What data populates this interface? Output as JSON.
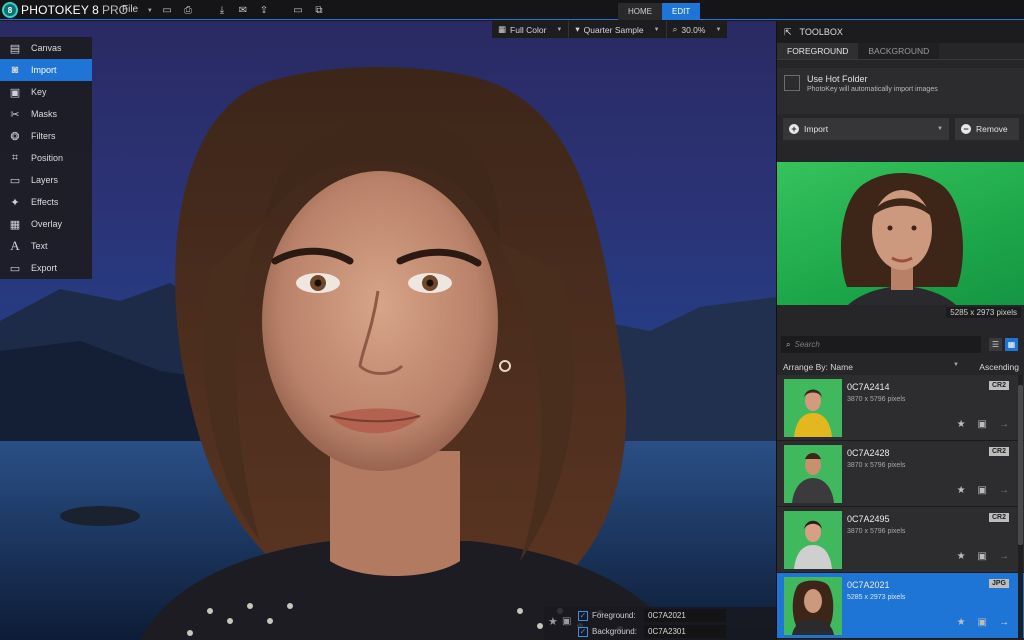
{
  "app": {
    "logo_name": "PHOTOKEY",
    "logo_version": "8",
    "logo_edition": "PRO"
  },
  "menu": {
    "file": "File"
  },
  "modes": {
    "home": "HOME",
    "edit": "EDIT"
  },
  "view_bar": {
    "color_mode": "Full Color",
    "sample": "Quarter Sample",
    "zoom": "30.0%"
  },
  "left_menu": [
    {
      "label": "Canvas",
      "icon": "canvas-icon"
    },
    {
      "label": "Import",
      "icon": "camera-icon"
    },
    {
      "label": "Key",
      "icon": "key-icon"
    },
    {
      "label": "Masks",
      "icon": "scissors-icon"
    },
    {
      "label": "Filters",
      "icon": "filters-icon"
    },
    {
      "label": "Position",
      "icon": "crop-icon"
    },
    {
      "label": "Layers",
      "icon": "layers-icon"
    },
    {
      "label": "Effects",
      "icon": "magic-wand-icon"
    },
    {
      "label": "Overlay",
      "icon": "grid-icon"
    },
    {
      "label": "Text",
      "icon": "text-icon"
    },
    {
      "label": "Export",
      "icon": "export-icon"
    }
  ],
  "canvas_footer": {
    "foreground_label": "Foreground:",
    "foreground_value": "0C7A2021",
    "background_label": "Background:",
    "background_value": "0C7A2301"
  },
  "toolbox": {
    "title": "TOOLBOX",
    "tabs": [
      "FOREGROUND",
      "BACKGROUND"
    ],
    "hot_folder_title": "Use Hot Folder",
    "hot_folder_sub": "PhotoKey will automatically import images",
    "import_label": "Import",
    "remove_label": "Remove",
    "preview_size": "5285 x 2973 pixels",
    "search_placeholder": "Search",
    "arrange_label": "Arrange By: Name",
    "order_label": "Ascending"
  },
  "files": [
    {
      "name": "0C7A2414",
      "size": "3870 x 5796 pixels",
      "type": "CR2",
      "shirt": "#e3b81e"
    },
    {
      "name": "0C7A2428",
      "size": "3870 x 5796 pixels",
      "type": "CR2",
      "shirt": "#3b3b3d"
    },
    {
      "name": "0C7A2495",
      "size": "3870 x 5796 pixels",
      "type": "CR2",
      "shirt": "#cfcfcf"
    },
    {
      "name": "0C7A2021",
      "size": "5285 x 2973 pixels",
      "type": "JPG",
      "shirt": "#2b2b2e"
    }
  ],
  "colors": {
    "accent": "#1f75d6",
    "toolbox_bg": "#262628",
    "green_screen": "#2cb852"
  }
}
